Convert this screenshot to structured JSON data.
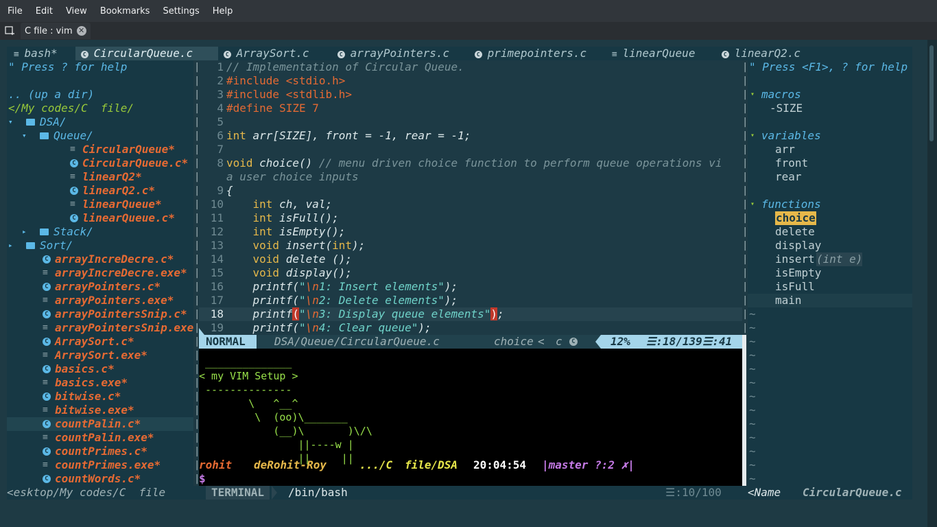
{
  "menubar": {
    "items": [
      "File",
      "Edit",
      "View",
      "Bookmarks",
      "Settings",
      "Help"
    ]
  },
  "tabbar": {
    "tab_title": "C file : vim",
    "new_tab_icon": "new-tab-icon",
    "close_icon": "close-icon"
  },
  "vim_tabs": [
    {
      "label": "bash*",
      "icon": "≡"
    },
    {
      "label": "CircularQueue.c",
      "icon": "🅒",
      "active": true
    },
    {
      "label": "ArraySort.c",
      "icon": "🅒"
    },
    {
      "label": "arrayPointers.c",
      "icon": "🅒"
    },
    {
      "label": "primepointers.c",
      "icon": "🅒"
    },
    {
      "label": "linearQueue",
      "icon": "≡"
    },
    {
      "label": "linearQ2.c",
      "icon": "🅒"
    }
  ],
  "nerdtree": {
    "help": "\" Press ? for help",
    "updir": ".. (up a dir)",
    "root": "</My codes/C  file/",
    "items": [
      {
        "indent": 0,
        "arrow": "▾",
        "icon": "folder",
        "name": "DSA/",
        "type": "dir"
      },
      {
        "indent": 1,
        "arrow": "▾",
        "icon": "folder",
        "name": "Queue/",
        "type": "dir"
      },
      {
        "indent": 3,
        "icon": "≡",
        "name": "CircularQueue*",
        "type": "exe"
      },
      {
        "indent": 3,
        "icon": "c",
        "name": "CircularQueue.c*",
        "type": "c"
      },
      {
        "indent": 3,
        "icon": "≡",
        "name": "linearQ2*",
        "type": "exe"
      },
      {
        "indent": 3,
        "icon": "c",
        "name": "linearQ2.c*",
        "type": "c"
      },
      {
        "indent": 3,
        "icon": "≡",
        "name": "linearQueue*",
        "type": "exe"
      },
      {
        "indent": 3,
        "icon": "c",
        "name": "linearQueue.c*",
        "type": "c"
      },
      {
        "indent": 1,
        "arrow": "▸",
        "icon": "folder",
        "name": "Stack/",
        "type": "dir"
      },
      {
        "indent": 0,
        "arrow": "▸",
        "icon": "folder",
        "name": "Sort/",
        "type": "dir"
      },
      {
        "indent": 1,
        "icon": "c",
        "name": "arrayIncreDecre.c*",
        "type": "c"
      },
      {
        "indent": 1,
        "icon": "≡",
        "name": "arrayIncreDecre.exe*",
        "type": "exe"
      },
      {
        "indent": 1,
        "icon": "c",
        "name": "arrayPointers.c*",
        "type": "c"
      },
      {
        "indent": 1,
        "icon": "≡",
        "name": "arrayPointers.exe*",
        "type": "exe"
      },
      {
        "indent": 1,
        "icon": "c",
        "name": "arrayPointersSnip.c*",
        "type": "c"
      },
      {
        "indent": 1,
        "icon": "≡",
        "name": "arrayPointersSnip.exe*",
        "type": "exe"
      },
      {
        "indent": 1,
        "icon": "c",
        "name": "ArraySort.c*",
        "type": "c"
      },
      {
        "indent": 1,
        "icon": "≡",
        "name": "ArraySort.exe*",
        "type": "exe"
      },
      {
        "indent": 1,
        "icon": "c",
        "name": "basics.c*",
        "type": "c"
      },
      {
        "indent": 1,
        "icon": "≡",
        "name": "basics.exe*",
        "type": "exe"
      },
      {
        "indent": 1,
        "icon": "c",
        "name": "bitwise.c*",
        "type": "c"
      },
      {
        "indent": 1,
        "icon": "≡",
        "name": "bitwise.exe*",
        "type": "exe"
      },
      {
        "indent": 1,
        "icon": "c",
        "name": "countPalin.c*",
        "type": "c",
        "selected": true
      },
      {
        "indent": 1,
        "icon": "≡",
        "name": "countPalin.exe*",
        "type": "exe"
      },
      {
        "indent": 1,
        "icon": "c",
        "name": "countPrimes.c*",
        "type": "c"
      },
      {
        "indent": 1,
        "icon": "≡",
        "name": "countPrimes.exe*",
        "type": "exe"
      },
      {
        "indent": 1,
        "icon": "c",
        "name": "countWords.c*",
        "type": "c"
      }
    ]
  },
  "editor": {
    "lines": [
      {
        "n": "1",
        "segs": [
          [
            "cm",
            "// Implementation of Circular Queue."
          ]
        ]
      },
      {
        "n": "2",
        "segs": [
          [
            "pp",
            "#include <stdio.h>"
          ]
        ]
      },
      {
        "n": "3",
        "segs": [
          [
            "pp",
            "#include <stdlib.h>"
          ]
        ]
      },
      {
        "n": "4",
        "segs": [
          [
            "pp",
            "#define SIZE 7"
          ]
        ]
      },
      {
        "n": "5",
        "segs": []
      },
      {
        "n": "6",
        "segs": [
          [
            "ty",
            "int"
          ],
          [
            "tx",
            " arr[SIZE], front = "
          ],
          [
            "nm",
            "-1"
          ],
          [
            "tx",
            ", rear = "
          ],
          [
            "nm",
            "-1"
          ],
          [
            "tx",
            ";"
          ]
        ]
      },
      {
        "n": "7",
        "segs": []
      },
      {
        "n": "8",
        "segs": [
          [
            "ty",
            "void"
          ],
          [
            "tx",
            " choice() "
          ],
          [
            "cm",
            "// menu driven choice function to perform queue operations vi"
          ]
        ]
      },
      {
        "n": "",
        "segs": [
          [
            "cm",
            "a user choice inputs"
          ]
        ]
      },
      {
        "n": "9",
        "segs": [
          [
            "tx",
            "{"
          ]
        ]
      },
      {
        "n": "10",
        "segs": [
          [
            "tx",
            "    "
          ],
          [
            "ty",
            "int"
          ],
          [
            "tx",
            " ch, val;"
          ]
        ]
      },
      {
        "n": "11",
        "segs": [
          [
            "tx",
            "    "
          ],
          [
            "ty",
            "int"
          ],
          [
            "tx",
            " isFull();"
          ]
        ]
      },
      {
        "n": "12",
        "segs": [
          [
            "tx",
            "    "
          ],
          [
            "ty",
            "int"
          ],
          [
            "tx",
            " isEmpty();"
          ]
        ]
      },
      {
        "n": "13",
        "segs": [
          [
            "tx",
            "    "
          ],
          [
            "ty",
            "void"
          ],
          [
            "tx",
            " insert("
          ],
          [
            "ty",
            "int"
          ],
          [
            "tx",
            ");"
          ]
        ]
      },
      {
        "n": "14",
        "segs": [
          [
            "tx",
            "    "
          ],
          [
            "ty",
            "void"
          ],
          [
            "tx",
            " delete ();"
          ]
        ]
      },
      {
        "n": "15",
        "segs": [
          [
            "tx",
            "    "
          ],
          [
            "ty",
            "void"
          ],
          [
            "tx",
            " display();"
          ]
        ]
      },
      {
        "n": "16",
        "segs": [
          [
            "tx",
            "    printf("
          ],
          [
            "st",
            "\""
          ],
          [
            "es",
            "\\n"
          ],
          [
            "st",
            "1: Insert elements\""
          ],
          [
            "tx",
            ");"
          ]
        ]
      },
      {
        "n": "17",
        "segs": [
          [
            "tx",
            "    printf("
          ],
          [
            "st",
            "\""
          ],
          [
            "es",
            "\\n"
          ],
          [
            "st",
            "2: Delete elements\""
          ],
          [
            "tx",
            ");"
          ]
        ]
      },
      {
        "n": "18",
        "segs": [
          [
            "tx",
            "    printf"
          ],
          [
            "mp",
            "("
          ],
          [
            "st",
            "\""
          ],
          [
            "es",
            "\\n"
          ],
          [
            "st",
            "3: Display queue elements\""
          ],
          [
            "mp",
            ")"
          ],
          [
            "tx",
            ";"
          ]
        ],
        "current": true
      },
      {
        "n": "19",
        "segs": [
          [
            "tx",
            "    printf("
          ],
          [
            "st",
            "\""
          ],
          [
            "es",
            "\\n"
          ],
          [
            "st",
            "4: Clear queue\""
          ],
          [
            "tx",
            ");"
          ]
        ]
      }
    ]
  },
  "statusline": {
    "mode": "NORMAL",
    "path": "DSA/Queue/CircularQueue.c",
    "func": "choice",
    "ft": "c",
    "percent": "12%",
    "line": "☰:18/139",
    "col": "☰:41"
  },
  "terminal": {
    "cowsay": [
      " ______________",
      "< my VIM Setup >",
      " --------------",
      "        \\   ^__^",
      "         \\  (oo)\\_______",
      "            (__)\\       )\\/\\",
      "                ||----w |",
      "                ||     ||"
    ],
    "prompt_user": "rohit",
    "prompt_host": "deRohit-Roy",
    "prompt_path1": ".../C",
    "prompt_path2": "file/DSA",
    "prompt_time": "20:04:54",
    "prompt_git": "|master ?:2 ✗|",
    "prompt_symbol": "$"
  },
  "tagbar": {
    "help": "\" Press <F1>, ? for help",
    "groups": [
      {
        "name": "macros",
        "items": [
          {
            "label": "-SIZE",
            "kind": "macro"
          }
        ]
      },
      {
        "name": "variables",
        "items": [
          {
            "label": "arr"
          },
          {
            "label": "front"
          },
          {
            "label": "rear"
          }
        ]
      },
      {
        "name": "functions",
        "items": [
          {
            "label": "choice",
            "highlight": true
          },
          {
            "label": "delete"
          },
          {
            "label": "display"
          },
          {
            "label": "insert",
            "sig": "(int e)"
          },
          {
            "label": "isEmpty"
          },
          {
            "label": "isFull"
          },
          {
            "label": "main",
            "cursor": true
          }
        ]
      }
    ]
  },
  "bottombar": {
    "nerd_path": "<esktop/My codes/C  file",
    "term_label": "TERMINAL",
    "term_shell": "/bin/bash",
    "term_pos": "☰:10/100",
    "tag_label": "<Name",
    "tag_file": "CircularQueue.c"
  },
  "colors": {
    "bg": "#1e3a44",
    "orange": "#e66a33",
    "green": "#98c93a",
    "cyan": "#5bb8e6",
    "comment": "#7a949a",
    "status_mode": "#a4d5ea"
  }
}
